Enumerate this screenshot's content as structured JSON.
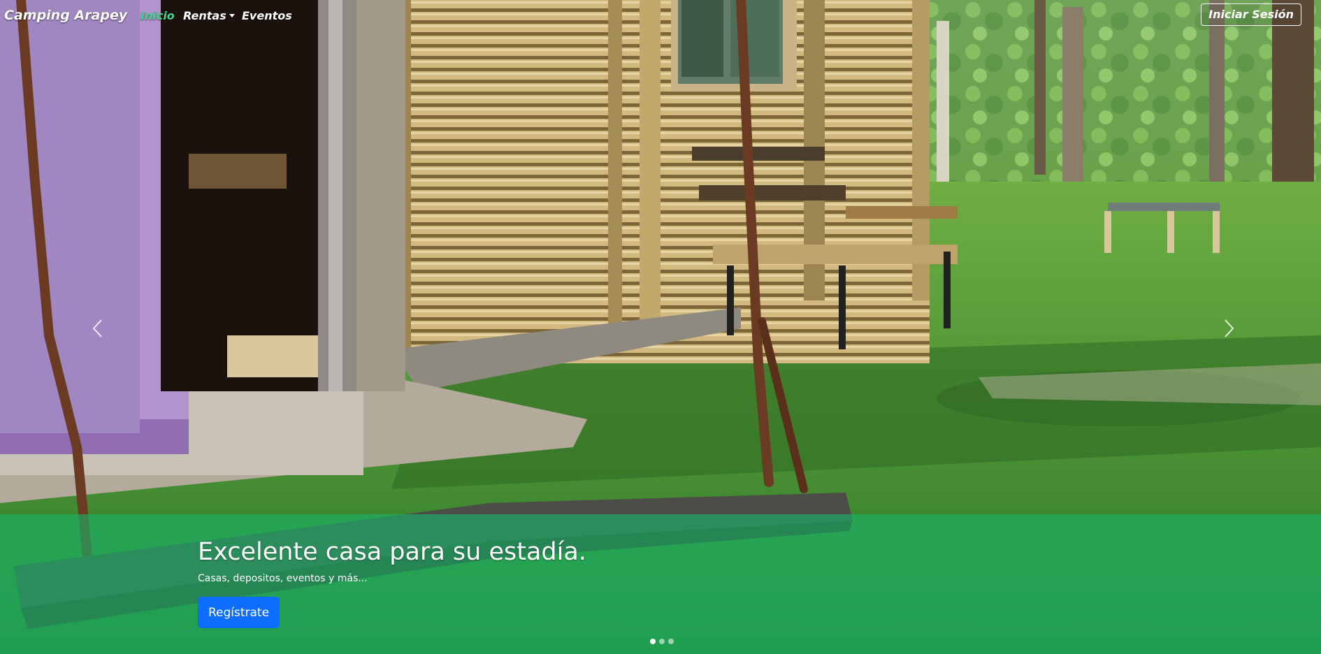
{
  "nav": {
    "brand": "Camping Arapey",
    "links": [
      {
        "label": "Inicio",
        "active": true
      },
      {
        "label": "Rentas",
        "dropdown": true
      },
      {
        "label": "Eventos"
      }
    ],
    "login_label": "Iniciar Sesión"
  },
  "carousel": {
    "slide_count": 3,
    "active_slide": 1,
    "caption": {
      "title": "Excelente casa para su estadía.",
      "subtitle": "Casas, depositos, eventos y más...",
      "button_label": "Regístrate"
    },
    "prev_icon": "chevron-left-icon",
    "next_icon": "chevron-right-icon"
  },
  "colors": {
    "active_link": "#47d28a",
    "caption_band": "#19b469",
    "cta_button": "#0d6efd"
  }
}
